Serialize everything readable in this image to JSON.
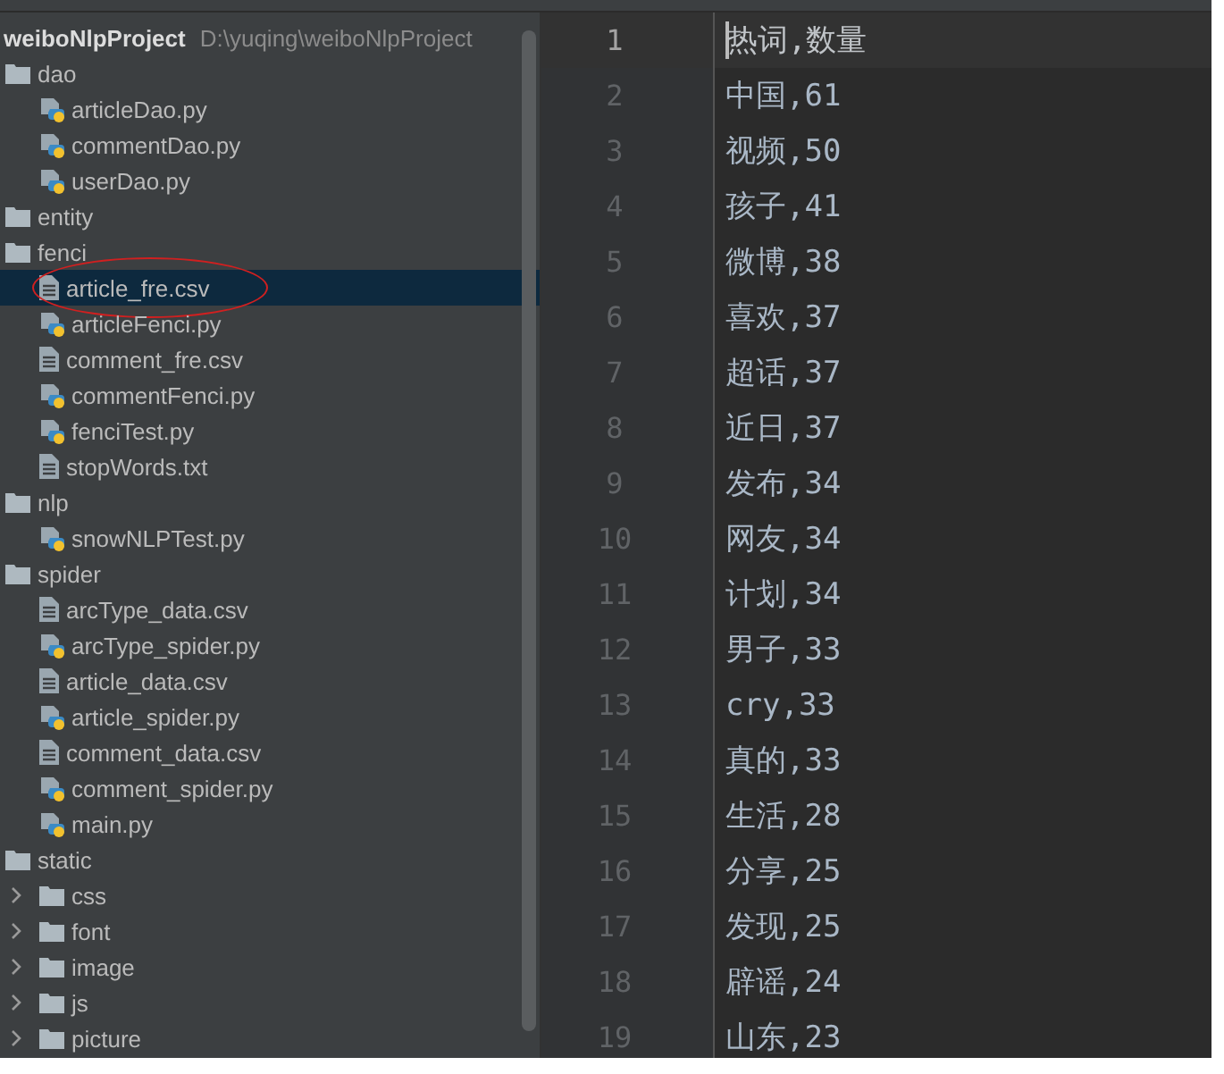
{
  "project_tree": {
    "root": {
      "name": "weiboNlpProject",
      "path": "D:\\yuqing\\weiboNlpProject"
    },
    "items": [
      {
        "name": "dao",
        "kind": "folder",
        "children": [
          {
            "name": "articleDao.py",
            "kind": "python"
          },
          {
            "name": "commentDao.py",
            "kind": "python"
          },
          {
            "name": "userDao.py",
            "kind": "python"
          }
        ]
      },
      {
        "name": "entity",
        "kind": "folder"
      },
      {
        "name": "fenci",
        "kind": "folder",
        "children": [
          {
            "name": "article_fre.csv",
            "kind": "text",
            "selected": true,
            "circled": true
          },
          {
            "name": "articleFenci.py",
            "kind": "python",
            "selected": false,
            "circled": false
          },
          {
            "name": "comment_fre.csv",
            "kind": "text",
            "selected": false,
            "circled": false
          },
          {
            "name": "commentFenci.py",
            "kind": "python",
            "selected": false,
            "circled": false
          },
          {
            "name": "fenciTest.py",
            "kind": "python",
            "selected": false,
            "circled": false
          },
          {
            "name": "stopWords.txt",
            "kind": "text",
            "selected": false,
            "circled": false
          }
        ]
      },
      {
        "name": "nlp",
        "kind": "folder",
        "children": [
          {
            "name": "snowNLPTest.py",
            "kind": "python"
          }
        ]
      },
      {
        "name": "spider",
        "kind": "folder",
        "children": [
          {
            "name": "arcType_data.csv",
            "kind": "text"
          },
          {
            "name": "arcType_spider.py",
            "kind": "python"
          },
          {
            "name": "article_data.csv",
            "kind": "text"
          },
          {
            "name": "article_spider.py",
            "kind": "python"
          },
          {
            "name": "comment_data.csv",
            "kind": "text"
          },
          {
            "name": "comment_spider.py",
            "kind": "python"
          },
          {
            "name": "main.py",
            "kind": "python"
          }
        ]
      },
      {
        "name": "static",
        "kind": "folder",
        "children": [
          {
            "name": "css",
            "kind": "folder",
            "expanded": false
          },
          {
            "name": "font",
            "kind": "folder",
            "expanded": false
          },
          {
            "name": "image",
            "kind": "folder",
            "expanded": false
          },
          {
            "name": "js",
            "kind": "folder",
            "expanded": false
          },
          {
            "name": "picture",
            "kind": "folder",
            "expanded": false
          }
        ]
      }
    ]
  },
  "editor": {
    "lines": [
      {
        "number": "1",
        "text": "热词,数量",
        "current": true
      },
      {
        "number": "2",
        "text": "中国,61",
        "current": false
      },
      {
        "number": "3",
        "text": "视频,50",
        "current": false
      },
      {
        "number": "4",
        "text": "孩子,41",
        "current": false
      },
      {
        "number": "5",
        "text": "微博,38",
        "current": false
      },
      {
        "number": "6",
        "text": "喜欢,37",
        "current": false
      },
      {
        "number": "7",
        "text": "超话,37",
        "current": false
      },
      {
        "number": "8",
        "text": "近日,37",
        "current": false
      },
      {
        "number": "9",
        "text": "发布,34",
        "current": false
      },
      {
        "number": "10",
        "text": "网友,34",
        "current": false
      },
      {
        "number": "11",
        "text": "计划,34",
        "current": false
      },
      {
        "number": "12",
        "text": "男子,33",
        "current": false
      },
      {
        "number": "13",
        "text": "cry,33",
        "current": false
      },
      {
        "number": "14",
        "text": "真的,33",
        "current": false
      },
      {
        "number": "15",
        "text": "生活,28",
        "current": false
      },
      {
        "number": "16",
        "text": "分享,25",
        "current": false
      },
      {
        "number": "17",
        "text": "发现,25",
        "current": false
      },
      {
        "number": "18",
        "text": "辟谣,24",
        "current": false
      },
      {
        "number": "19",
        "text": "山东,23",
        "current": false
      }
    ]
  }
}
